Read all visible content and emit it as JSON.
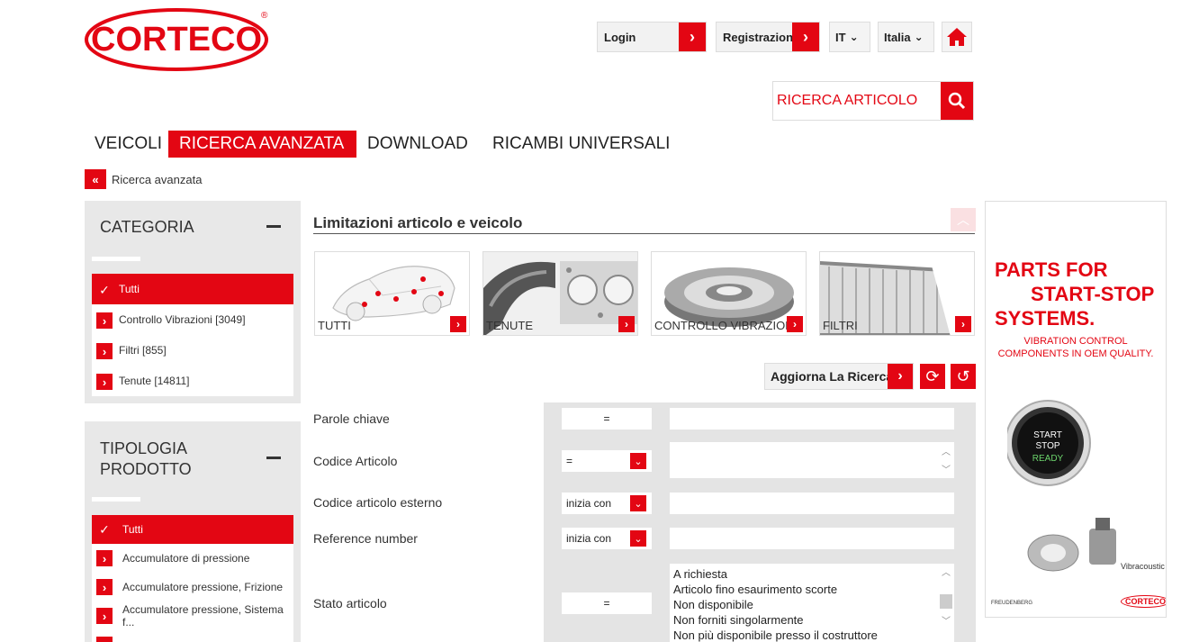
{
  "brand": {
    "logo_text": "CORTECO",
    "registered": "®",
    "accent": "#e30613"
  },
  "header": {
    "login_label": "Login",
    "register_label": "Registrazione",
    "language": "IT",
    "country": "Italia"
  },
  "search": {
    "placeholder": "RICERCA ARTICOLO"
  },
  "nav": [
    "VEICOLI",
    "RICERCA AVANZATA",
    "DOWNLOAD",
    "RICAMBI UNIVERSALI"
  ],
  "breadcrumb": {
    "back": "«",
    "label": "Ricerca avanzata"
  },
  "sidebar": {
    "categoria": {
      "title": "CATEGORIA",
      "items": [
        "Tutti",
        "Controllo Vibrazioni [3049]",
        "Filtri [855]",
        "Tenute [14811]"
      ]
    },
    "tipologia": {
      "title_line1": "TIPOLOGIA",
      "title_line2": "PRODOTTO",
      "items": [
        "Tutti",
        "Accumulatore di pressione",
        "Accumulatore pressione, Frizione",
        "Accumulatore pressione, Sistema f..."
      ]
    }
  },
  "main": {
    "section_title": "Limitazioni articolo e veicolo",
    "cards": [
      "TUTTI",
      "TENUTE",
      "CONTROLLO VIBRAZIONI",
      "FILTRI"
    ],
    "update_label": "Aggiorna La Ricerca",
    "fields": {
      "parole": {
        "label": "Parole chiave",
        "op": "="
      },
      "codice": {
        "label": "Codice Articolo",
        "op": "="
      },
      "esterno": {
        "label": "Codice articolo esterno",
        "op": "inizia con"
      },
      "reference": {
        "label": "Reference number",
        "op": "inizia con"
      },
      "stato": {
        "label": "Stato articolo",
        "op": "=",
        "options": [
          "A richiesta",
          "Articolo fino esaurimento scorte",
          "Non disponibile",
          "Non forniti singolarmente",
          "Non più disponibile presso il costruttore"
        ]
      }
    }
  },
  "ad": {
    "line1": "PARTS FOR",
    "line2": "START-STOP",
    "line3": "SYSTEMS.",
    "sub1": "VIBRATION CONTROL",
    "sub2": "COMPONENTS IN OEM QUALITY.",
    "button_line1": "START",
    "button_line2": "STOP",
    "button_line3": "READY",
    "vibracoustic": "Vibracoustic",
    "freudenberg": "FREUDENBERG",
    "logo": "CORTECO"
  }
}
